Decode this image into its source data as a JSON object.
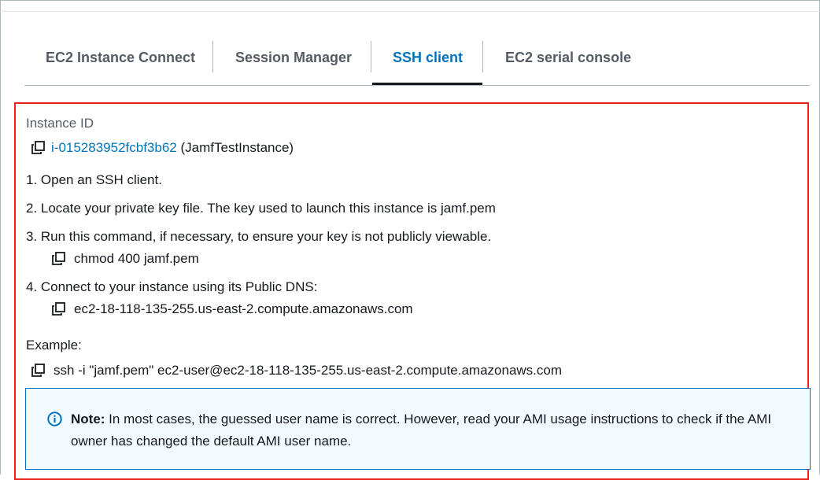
{
  "tabs": [
    {
      "label": "EC2 Instance Connect",
      "active": false
    },
    {
      "label": "Session Manager",
      "active": false
    },
    {
      "label": "SSH client",
      "active": true
    },
    {
      "label": "EC2 serial console",
      "active": false
    }
  ],
  "instance": {
    "label": "Instance ID",
    "id": "i-015283952fcbf3b62",
    "name": "(JamfTestInstance)"
  },
  "steps": {
    "step1": "1. Open an SSH client.",
    "step2": "2. Locate your private key file. The key used to launch this instance is jamf.pem",
    "step3": "3. Run this command, if necessary, to ensure your key is not publicly viewable.",
    "step3_cmd": "chmod 400 jamf.pem",
    "step4": "4. Connect to your instance using its Public DNS:",
    "step4_cmd": "ec2-18-118-135-255.us-east-2.compute.amazonaws.com"
  },
  "example": {
    "label": "Example:",
    "cmd": "ssh -i \"jamf.pem\" ec2-user@ec2-18-118-135-255.us-east-2.compute.amazonaws.com"
  },
  "note": {
    "title": "Note:",
    "text": " In most cases, the guessed user name is correct. However, read your AMI usage instructions to check if the AMI owner has changed the default AMI user name."
  },
  "colors": {
    "accent": "#0073bb",
    "highlight_border": "#e8241c",
    "note_bg": "#f1faff"
  },
  "icons": {
    "copy": "copy-icon",
    "info": "info-icon"
  }
}
